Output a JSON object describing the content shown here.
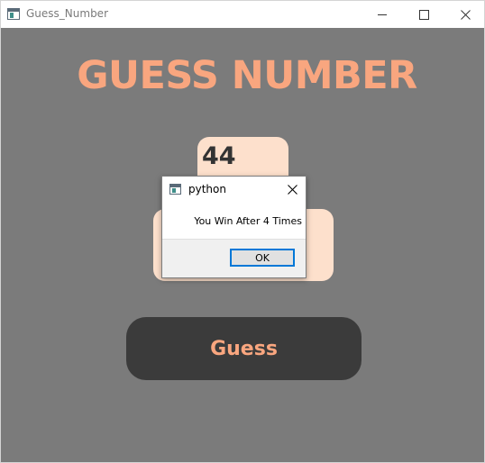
{
  "window": {
    "title": "Guess_Number",
    "icon": "window-app-icon",
    "controls": [
      "minimize-icon",
      "maximize-icon",
      "close-icon"
    ]
  },
  "app": {
    "heading": "GUESS NUMBER",
    "guess_value": "44",
    "button_label": "Guess"
  },
  "dialog": {
    "title": "python",
    "message": "You Win After 4 Times",
    "ok_label": "OK"
  },
  "colors": {
    "background": "#7b7b7b",
    "accent": "#f9a67f",
    "panel": "#fde0cc",
    "button": "#3b3b3b",
    "focus": "#0078d7"
  }
}
